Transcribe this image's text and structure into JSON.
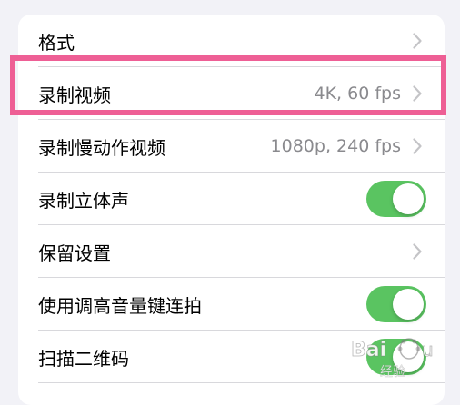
{
  "settings": {
    "rows": [
      {
        "label": "格式",
        "value": "",
        "control": "chevron"
      },
      {
        "label": "录制视频",
        "value": "4K, 60 fps",
        "control": "chevron"
      },
      {
        "label": "录制慢动作视频",
        "value": "1080p, 240 fps",
        "control": "chevron"
      },
      {
        "label": "录制立体声",
        "value": "",
        "control": "toggle",
        "toggle_on": true
      },
      {
        "label": "保留设置",
        "value": "",
        "control": "chevron"
      },
      {
        "label": "使用调高音量键连拍",
        "value": "",
        "control": "toggle",
        "toggle_on": true
      },
      {
        "label": "扫描二维码",
        "value": "",
        "control": "toggle",
        "toggle_on": true
      }
    ]
  },
  "annotation": {
    "highlight_color": "#ee5f95",
    "highlighted_row": "录制视频"
  },
  "watermark": {
    "text": "Baidu 经验"
  },
  "colors": {
    "background": "#f2f2f7",
    "card": "#ffffff",
    "toggle_on": "#5ac461",
    "secondary_text": "#8a8a8e",
    "chevron": "#c4c4c7"
  }
}
